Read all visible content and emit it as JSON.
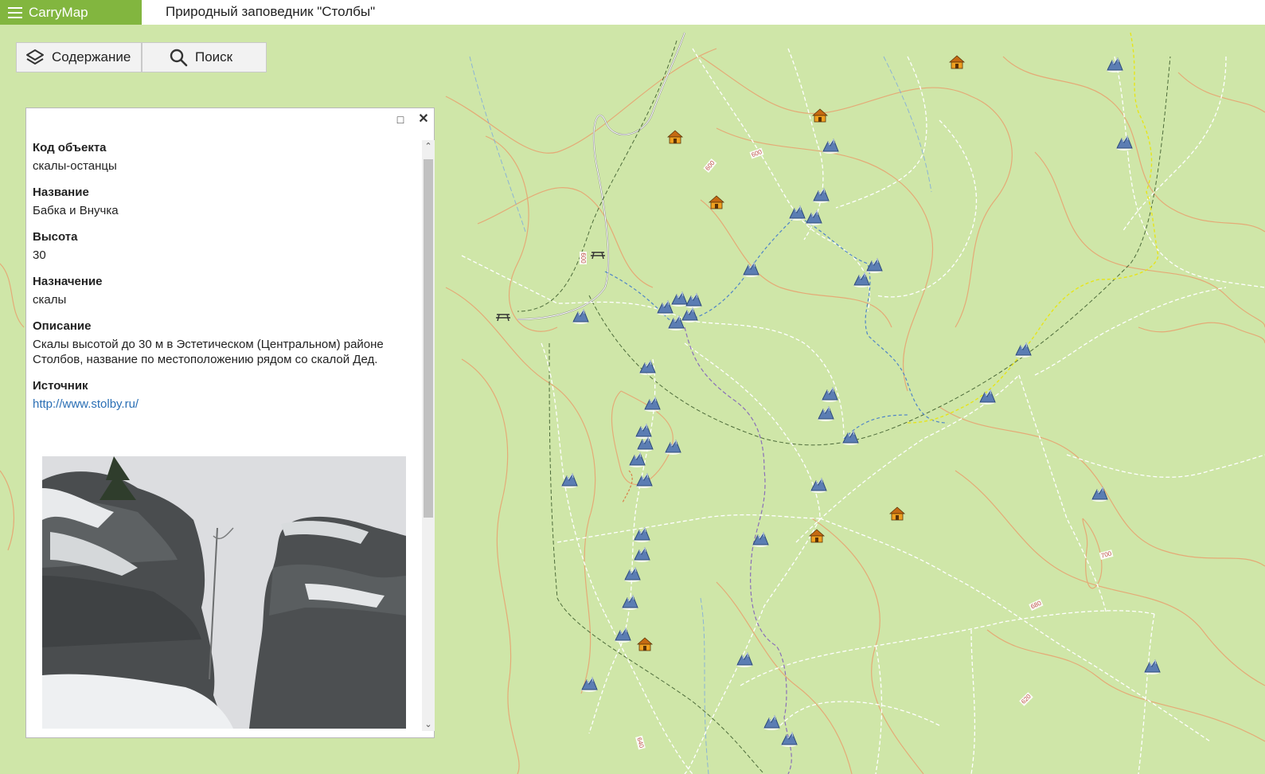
{
  "app": {
    "brand": "CarryMap",
    "map_title": "Природный заповедник \"Столбы\""
  },
  "toolbar": {
    "contents_label": "Содержание",
    "search_label": "Поиск"
  },
  "info": {
    "fields": [
      {
        "label": "Код объекта",
        "value": "скалы-останцы"
      },
      {
        "label": "Название",
        "value": "Бабка и Внучка"
      },
      {
        "label": "Высота",
        "value": "30"
      },
      {
        "label": "Назначение",
        "value": "скалы"
      },
      {
        "label": "Описание",
        "value": "Скалы высотой до 30 м в Эстетическом (Центральном) районе Столбов, название по местоположению рядом со скалой Дед."
      },
      {
        "label": "Источник",
        "value": "http://www.stolby.ru/"
      }
    ]
  },
  "map": {
    "contour_labels": [
      "600",
      "600",
      "600",
      "700",
      "680",
      "620",
      "640"
    ],
    "colors": {
      "land": "#cfe6a8",
      "contour": "#e8a06e",
      "trail": "#ffffff",
      "stream": "#5a88c9",
      "boundary_yellow": "#e6e51a",
      "purple_trail": "#8a6fb8",
      "road": "#8a8a8a",
      "brand": "#82b63f"
    }
  }
}
